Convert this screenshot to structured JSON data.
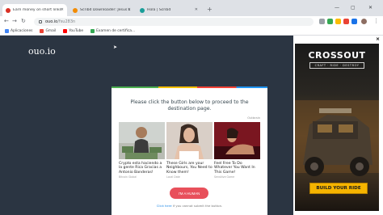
{
  "browser": {
    "tabs": [
      {
        "label": "Earn money on short links. Make",
        "color": "#d93025",
        "active": true
      },
      {
        "label": "Scribd Downloader: Jesus Down",
        "color": "#f28b00",
        "active": false
      },
      {
        "label": "Hola | Scribd",
        "color": "#1a9e99",
        "active": false
      }
    ],
    "new_tab": "+",
    "url_host": "ouo.io",
    "url_path": "/fsu283n"
  },
  "bookmarks": [
    {
      "label": "Aplicaciones",
      "color": "#4285f4"
    },
    {
      "label": "Gmail",
      "color": "#ea4335"
    },
    {
      "label": "YouTube",
      "color": "#ff0000"
    },
    {
      "label": "Examen de certifica...",
      "color": "#34a853"
    }
  ],
  "site": {
    "logo": "ouo.io",
    "instruction": "Please click the button below to proceed to the destination page.",
    "outbrain_label": "Outbrain",
    "ads": [
      {
        "title": "Crypto esta haciendo a la gente Rica Gracias a Antonio Banderas!",
        "source": "Bitcoin Global"
      },
      {
        "title": "These Girls are your Neighbours, You Need to Know them!",
        "source": "Local Date"
      },
      {
        "title": "Feel Free To Do Whatever You Want In This Game!",
        "source": "Sensitive Game"
      }
    ],
    "human_button": "I'M A HUMAN",
    "help_link": "Click here",
    "help_text": " if you cannot submit the button."
  },
  "side_ad": {
    "close": "×",
    "title": "CROSSOUT",
    "subtitle": "CRAFT · RIDE · DESTROY",
    "cta": "BUILD YOUR RIDE"
  }
}
